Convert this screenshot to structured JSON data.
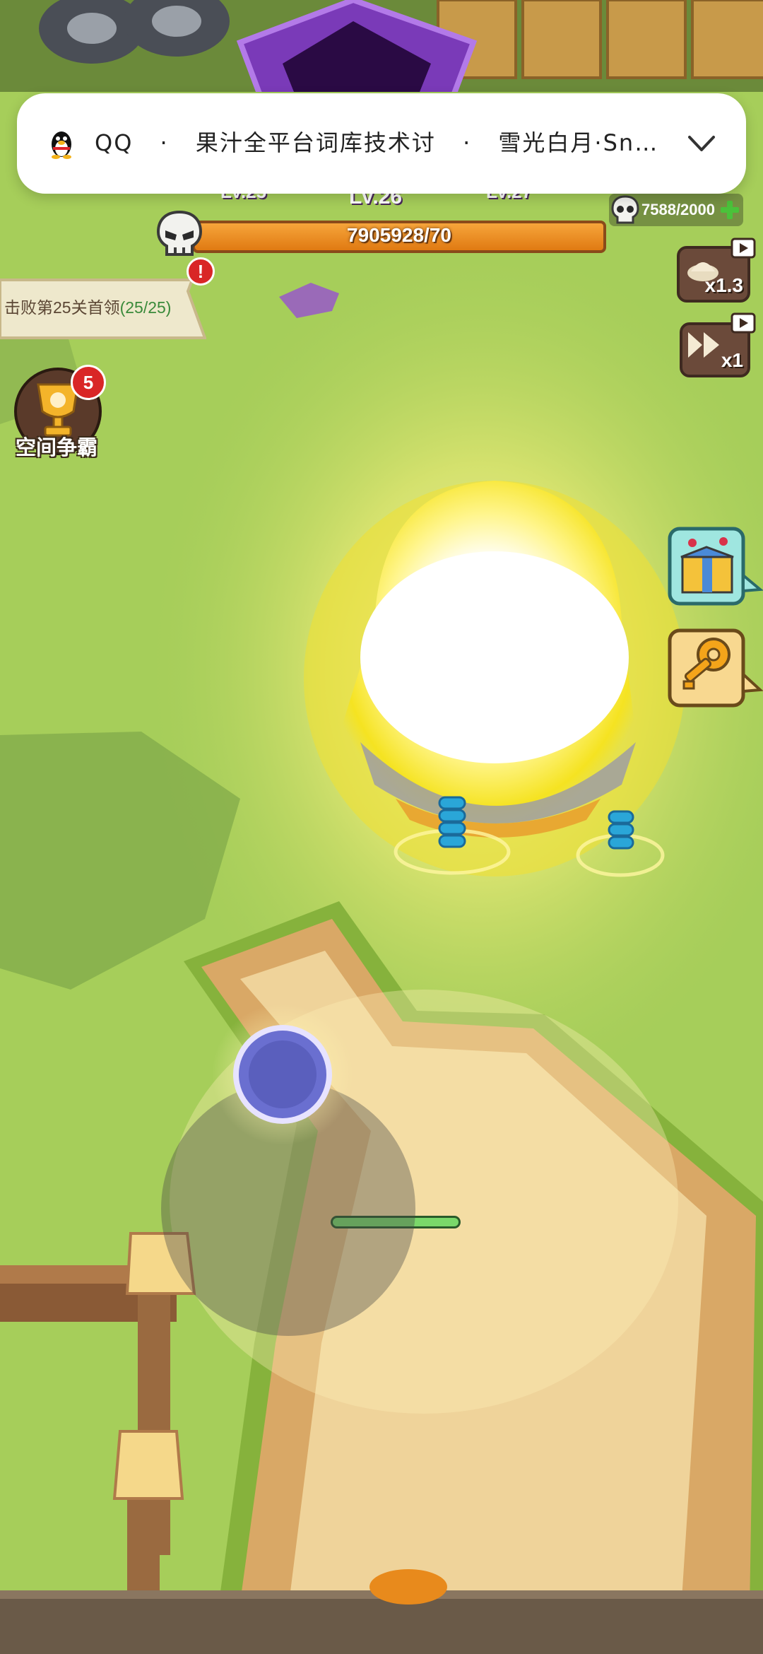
{
  "notification": {
    "app": "QQ",
    "separator1": "·",
    "group": "果汁全平台词库技术讨",
    "separator2": "·",
    "sender": "雪光白月·Sn…"
  },
  "boss": {
    "progress_text": "7905928/70",
    "level_left": "LV.25",
    "level_center": "LV.26",
    "level_right": "LV.27"
  },
  "currency": {
    "skulls": "7588/2000"
  },
  "quest": {
    "text": "击败第25关首领",
    "progress": "(25/25)"
  },
  "space_battle": {
    "label": "空间争霸",
    "badge": "5"
  },
  "buttons": {
    "xp_multiplier": "x1.3",
    "speed_multiplier": "x1"
  },
  "colors": {
    "grass": "#9fc856",
    "boss_bar": "#f08a1c",
    "path": "#e8c485",
    "joystick": "#6a6fd0"
  }
}
